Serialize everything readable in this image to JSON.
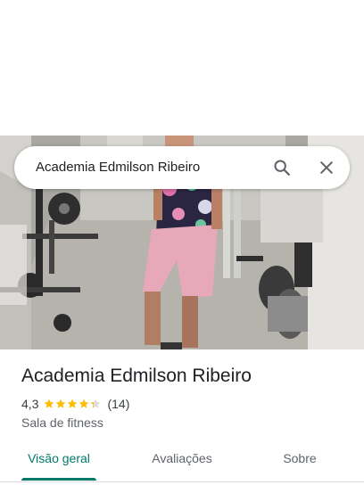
{
  "search": {
    "query": "Academia Edmilson Ribeiro",
    "search_icon": "search-icon",
    "close_icon": "close-icon"
  },
  "hero": {
    "photo": "gym-photo"
  },
  "place": {
    "name": "Academia Edmilson Ribeiro",
    "rating": "4,3",
    "rating_stars": 4.3,
    "reviews_count": "(14)",
    "category": "Sala de fitness"
  },
  "tabs": [
    {
      "label": "Visão geral",
      "active": true
    },
    {
      "label": "Avaliações",
      "active": false
    },
    {
      "label": "Sobre",
      "active": false
    }
  ],
  "colors": {
    "accent": "#00796b",
    "star": "#fbbc04"
  }
}
